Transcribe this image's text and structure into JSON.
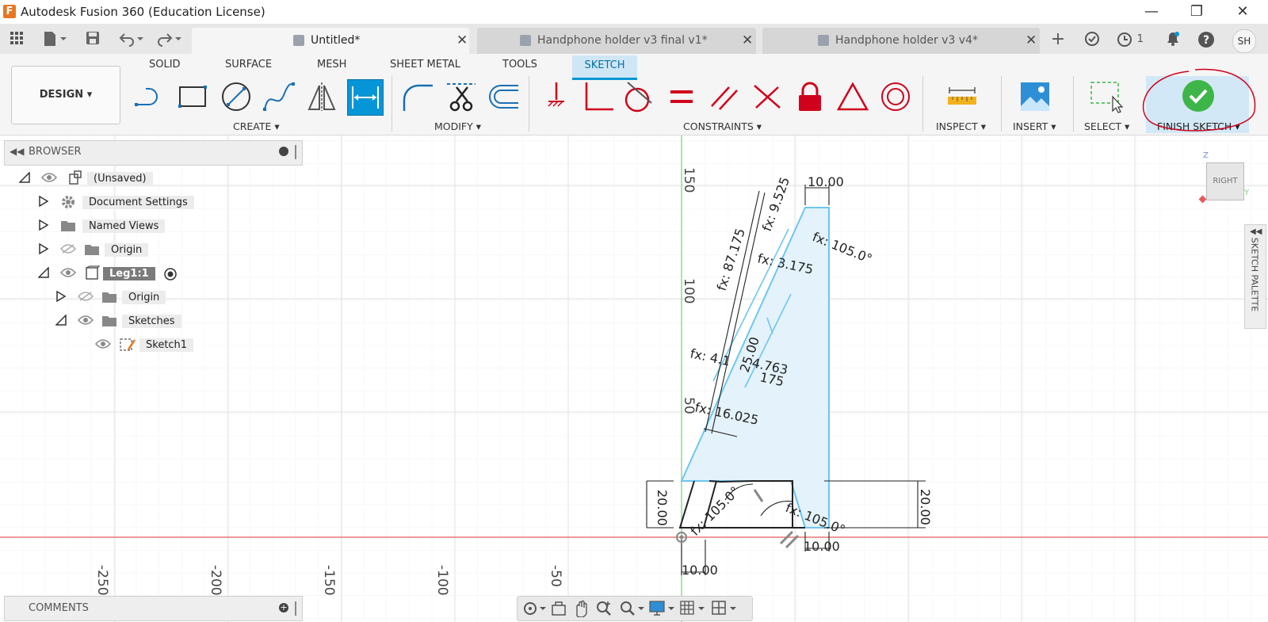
{
  "window": {
    "title": "Autodesk Fusion 360 (Education License)",
    "controls": {
      "minimize": "—",
      "restore": "❐",
      "close": "✕"
    }
  },
  "tabs": [
    {
      "label": "Untitled*",
      "active": true
    },
    {
      "label": "Handphone holder v3 final v1*",
      "active": false
    },
    {
      "label": "Handphone holder v3 v4*",
      "active": false
    }
  ],
  "tabbar_right": {
    "job_count": "1",
    "user_initials": "SH"
  },
  "ribbon": {
    "workspace": "DESIGN",
    "tabs": [
      "SOLID",
      "SURFACE",
      "MESH",
      "SHEET METAL",
      "TOOLS",
      "SKETCH"
    ],
    "active_tab": "SKETCH",
    "groups": {
      "create": "CREATE",
      "modify": "MODIFY",
      "constraints": "CONSTRAINTS",
      "inspect": "INSPECT",
      "insert": "INSERT",
      "select": "SELECT",
      "finish": "FINISH SKETCH"
    }
  },
  "browser": {
    "title": "BROWSER",
    "items": [
      {
        "label": "(Unsaved)",
        "expanded": true
      },
      {
        "label": "Document Settings",
        "expanded": false
      },
      {
        "label": "Named Views",
        "expanded": false
      },
      {
        "label": "Origin",
        "expanded": false
      },
      {
        "label": "Leg1:1",
        "expanded": true,
        "selected": true
      },
      {
        "label": "Origin",
        "expanded": false
      },
      {
        "label": "Sketches",
        "expanded": true
      },
      {
        "label": "Sketch1"
      }
    ]
  },
  "comments": {
    "title": "COMMENTS"
  },
  "sketch_palette": {
    "label": "SKETCH PALETTE"
  },
  "viewcube": {
    "face": "RIGHT",
    "z": "Z",
    "y": "Y"
  },
  "axis_labels": {
    "horizontal": [
      "-250",
      "-200",
      "-150",
      "-100",
      "-50"
    ],
    "vertical": [
      "150",
      "100",
      "50"
    ]
  },
  "dimensions": {
    "top_width": "10.00",
    "fx_9525": "fx: 9.525",
    "fx_105a": "fx: 105.0°",
    "fx_87175": "fx: 87.175",
    "fx_3175": "fx: 3.175",
    "d_25": "25.00",
    "fx_4": "fx: 4.1",
    "d_4763": "4.763",
    "d_175": "175",
    "fx_16025": "fx: 16.025",
    "left_height": "20.00",
    "fx_105b": "fx: 105.0°",
    "fx_105c": "fx: 105.0°",
    "right_height": "20.00",
    "bottom_10a": "10.00",
    "bottom_10b": "10.00"
  },
  "colors": {
    "accent": "#0696d7",
    "finish_green": "#3db549",
    "annotation_red": "#d0021b",
    "sketch_line": "#6ec6f0",
    "sketch_fill": "#e3f2fb"
  }
}
